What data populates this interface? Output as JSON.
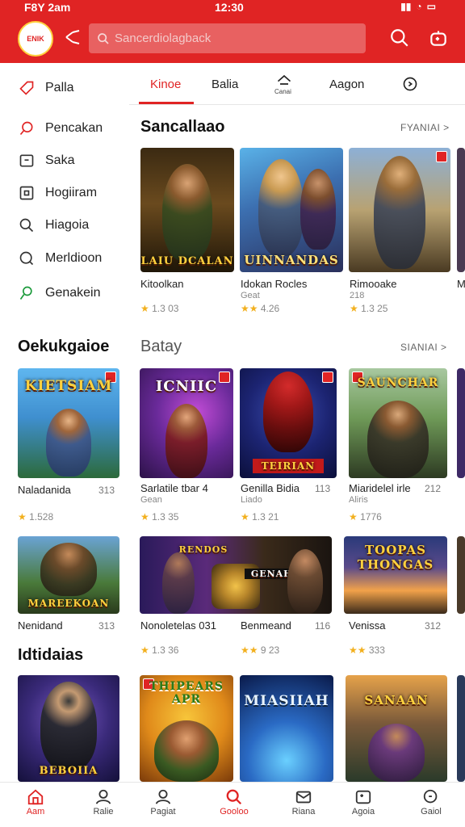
{
  "status_bar": {
    "left_time": "F8Y 2am",
    "center_time": "12:30"
  },
  "app": {
    "logo_text": "ENIK"
  },
  "search": {
    "placeholder": "Sancerdiolagback"
  },
  "sidebar": {
    "items": [
      {
        "label": "Palla",
        "icon": "tag-icon"
      },
      {
        "label": "Pencakan",
        "icon": "pin-icon"
      },
      {
        "label": "Saka",
        "icon": "chat-icon"
      },
      {
        "label": "Hogiiram",
        "icon": "square-icon"
      },
      {
        "label": "Hiagoia",
        "icon": "search-icon"
      },
      {
        "label": "Merldioon",
        "icon": "search-icon"
      },
      {
        "label": "Genakein",
        "icon": "user-icon"
      }
    ]
  },
  "tabs": [
    {
      "label": "Kinoe",
      "active": true
    },
    {
      "label": "Balia"
    },
    {
      "label": "Canai",
      "icon": "home-icon"
    },
    {
      "label": "Aagon"
    },
    {
      "label": "",
      "icon": "compass-icon"
    }
  ],
  "section1": {
    "title": "Sancallaao",
    "see_all": "FYANIAI >",
    "cards": [
      {
        "caption": "LAIU DCALAN",
        "title": "Kitoolkan",
        "sub": "",
        "rating": "1.3 03"
      },
      {
        "caption": "UINNANDAS",
        "title": "Idokan Rocles",
        "sub": "Geat",
        "rating": "4.26"
      },
      {
        "caption": "",
        "title": "Rimooake",
        "sub": "218",
        "rating": "1.3 25"
      },
      {
        "caption": "",
        "title": "M",
        "sub": "",
        "rating": ""
      }
    ]
  },
  "section2": {
    "title": "Oekukgaioe",
    "alt_title": "Batay",
    "see_all": "SIANIAI >",
    "cards": [
      {
        "caption": "KIETSIAM",
        "title": "Naladanida",
        "size": "313",
        "sub": "",
        "rating": "1.528"
      },
      {
        "caption": "ICNIIC",
        "title": "Sarlatile tbar 4",
        "size": "",
        "sub": "Gean",
        "rating": "1.3 35"
      },
      {
        "caption": "TEIRIAN",
        "title": "Genilla Bidia",
        "size": "113",
        "sub": "Liado",
        "rating": "1.3 21"
      },
      {
        "caption": "SAUNCHAR",
        "title": "Miaridelel irle",
        "size": "212",
        "sub": "Aliris",
        "rating": "1776"
      }
    ]
  },
  "section3": {
    "cards": [
      {
        "caption": "MAREEKOAN",
        "title": "Nenidand",
        "size": "313",
        "rating": "1.3 36"
      },
      {
        "caption": "RENDOS",
        "title": "Nonoletelas 031",
        "size": "",
        "rating": "9 23"
      },
      {
        "caption": "GENAHAN",
        "title": "Benmeand",
        "size": "116",
        "rating": ""
      },
      {
        "caption": "TOOPAS THONGAS",
        "title": "Venissa",
        "size": "312",
        "rating": "333"
      }
    ]
  },
  "section4": {
    "title": "Idtidaias",
    "cards": [
      {
        "caption": "BEBOIIA"
      },
      {
        "caption": "THIPEARS APR"
      },
      {
        "caption": "MIASIIAH"
      },
      {
        "caption": "SANAAN"
      }
    ]
  },
  "bottom_nav": [
    {
      "label": "Aam",
      "icon": "home-icon",
      "active": true
    },
    {
      "label": "Ralie",
      "icon": "user-icon"
    },
    {
      "label": "Pagiat",
      "icon": "user-icon"
    },
    {
      "label": "Gooloo",
      "icon": "search-icon",
      "highlight": true
    },
    {
      "label": "Riana",
      "icon": "mail-icon"
    },
    {
      "label": "Agoia",
      "icon": "game-icon"
    },
    {
      "label": "Gaiol",
      "icon": "search-icon"
    }
  ],
  "colors": {
    "brand": "#e02424",
    "accent": "#ffd23f",
    "star": "#f2b01e"
  }
}
